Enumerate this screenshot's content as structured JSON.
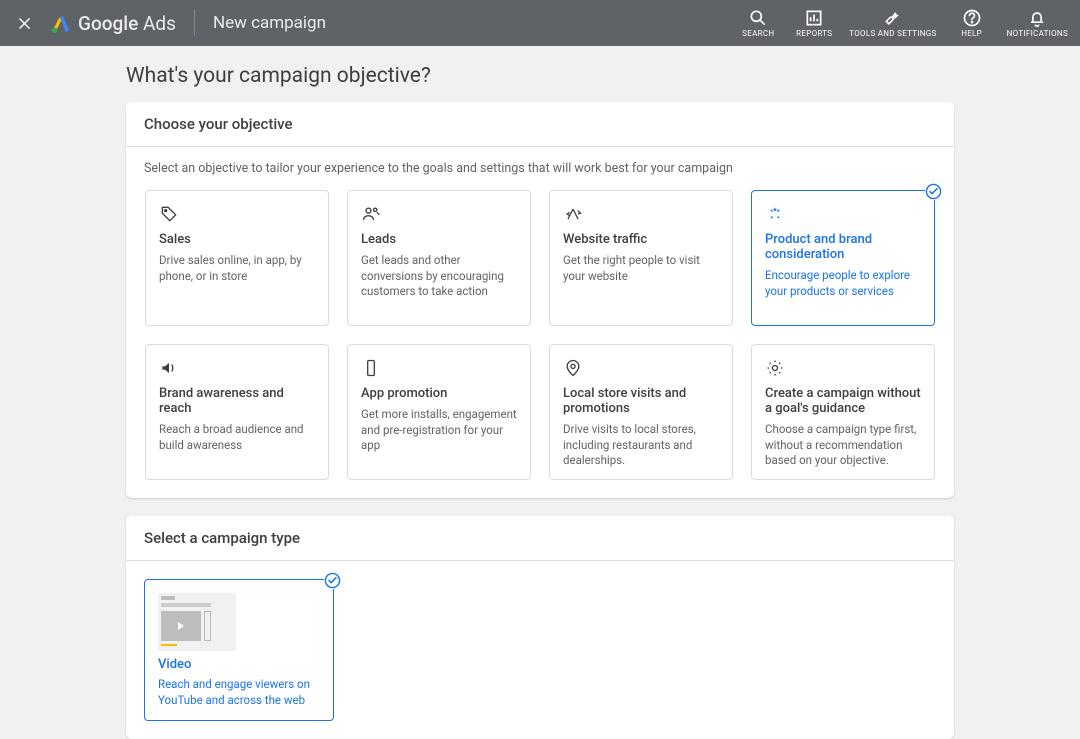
{
  "header": {
    "brand_main": "Google",
    "brand_sub": "Ads",
    "page_title": "New campaign",
    "actions": [
      {
        "id": "search",
        "label": "SEARCH"
      },
      {
        "id": "reports",
        "label": "REPORTS"
      },
      {
        "id": "tools",
        "label": "TOOLS AND SETTINGS"
      },
      {
        "id": "help",
        "label": "HELP"
      },
      {
        "id": "notifications",
        "label": "NOTIFICATIONS"
      }
    ]
  },
  "question": "What's your campaign objective?",
  "objective_card": {
    "title": "Choose your objective",
    "subtitle": "Select an objective to tailor your experience to the goals and settings that will work best for your campaign",
    "tiles": [
      {
        "id": "sales",
        "title": "Sales",
        "desc": "Drive sales online, in app, by phone, or in store",
        "selected": false
      },
      {
        "id": "leads",
        "title": "Leads",
        "desc": "Get leads and other conversions by encouraging customers to take action",
        "selected": false
      },
      {
        "id": "traffic",
        "title": "Website traffic",
        "desc": "Get the right people to visit your website",
        "selected": false
      },
      {
        "id": "consideration",
        "title": "Product and brand consideration",
        "desc": "Encourage people to explore your products or services",
        "selected": true
      },
      {
        "id": "awareness",
        "title": "Brand awareness and reach",
        "desc": "Reach a broad audience and build awareness",
        "selected": false
      },
      {
        "id": "app",
        "title": "App promotion",
        "desc": "Get more installs, engagement and pre-registration for your app",
        "selected": false
      },
      {
        "id": "local",
        "title": "Local store visits and promotions",
        "desc": "Drive visits to local stores, including restaurants and dealerships.",
        "selected": false
      },
      {
        "id": "none",
        "title": "Create a campaign without a goal's guidance",
        "desc": "Choose a campaign type first, without a recommendation based on your objective.",
        "selected": false
      }
    ]
  },
  "type_card": {
    "title": "Select a campaign type",
    "tiles": [
      {
        "id": "video",
        "title": "Video",
        "desc": "Reach and engage viewers on YouTube and across the web",
        "selected": true
      }
    ]
  }
}
